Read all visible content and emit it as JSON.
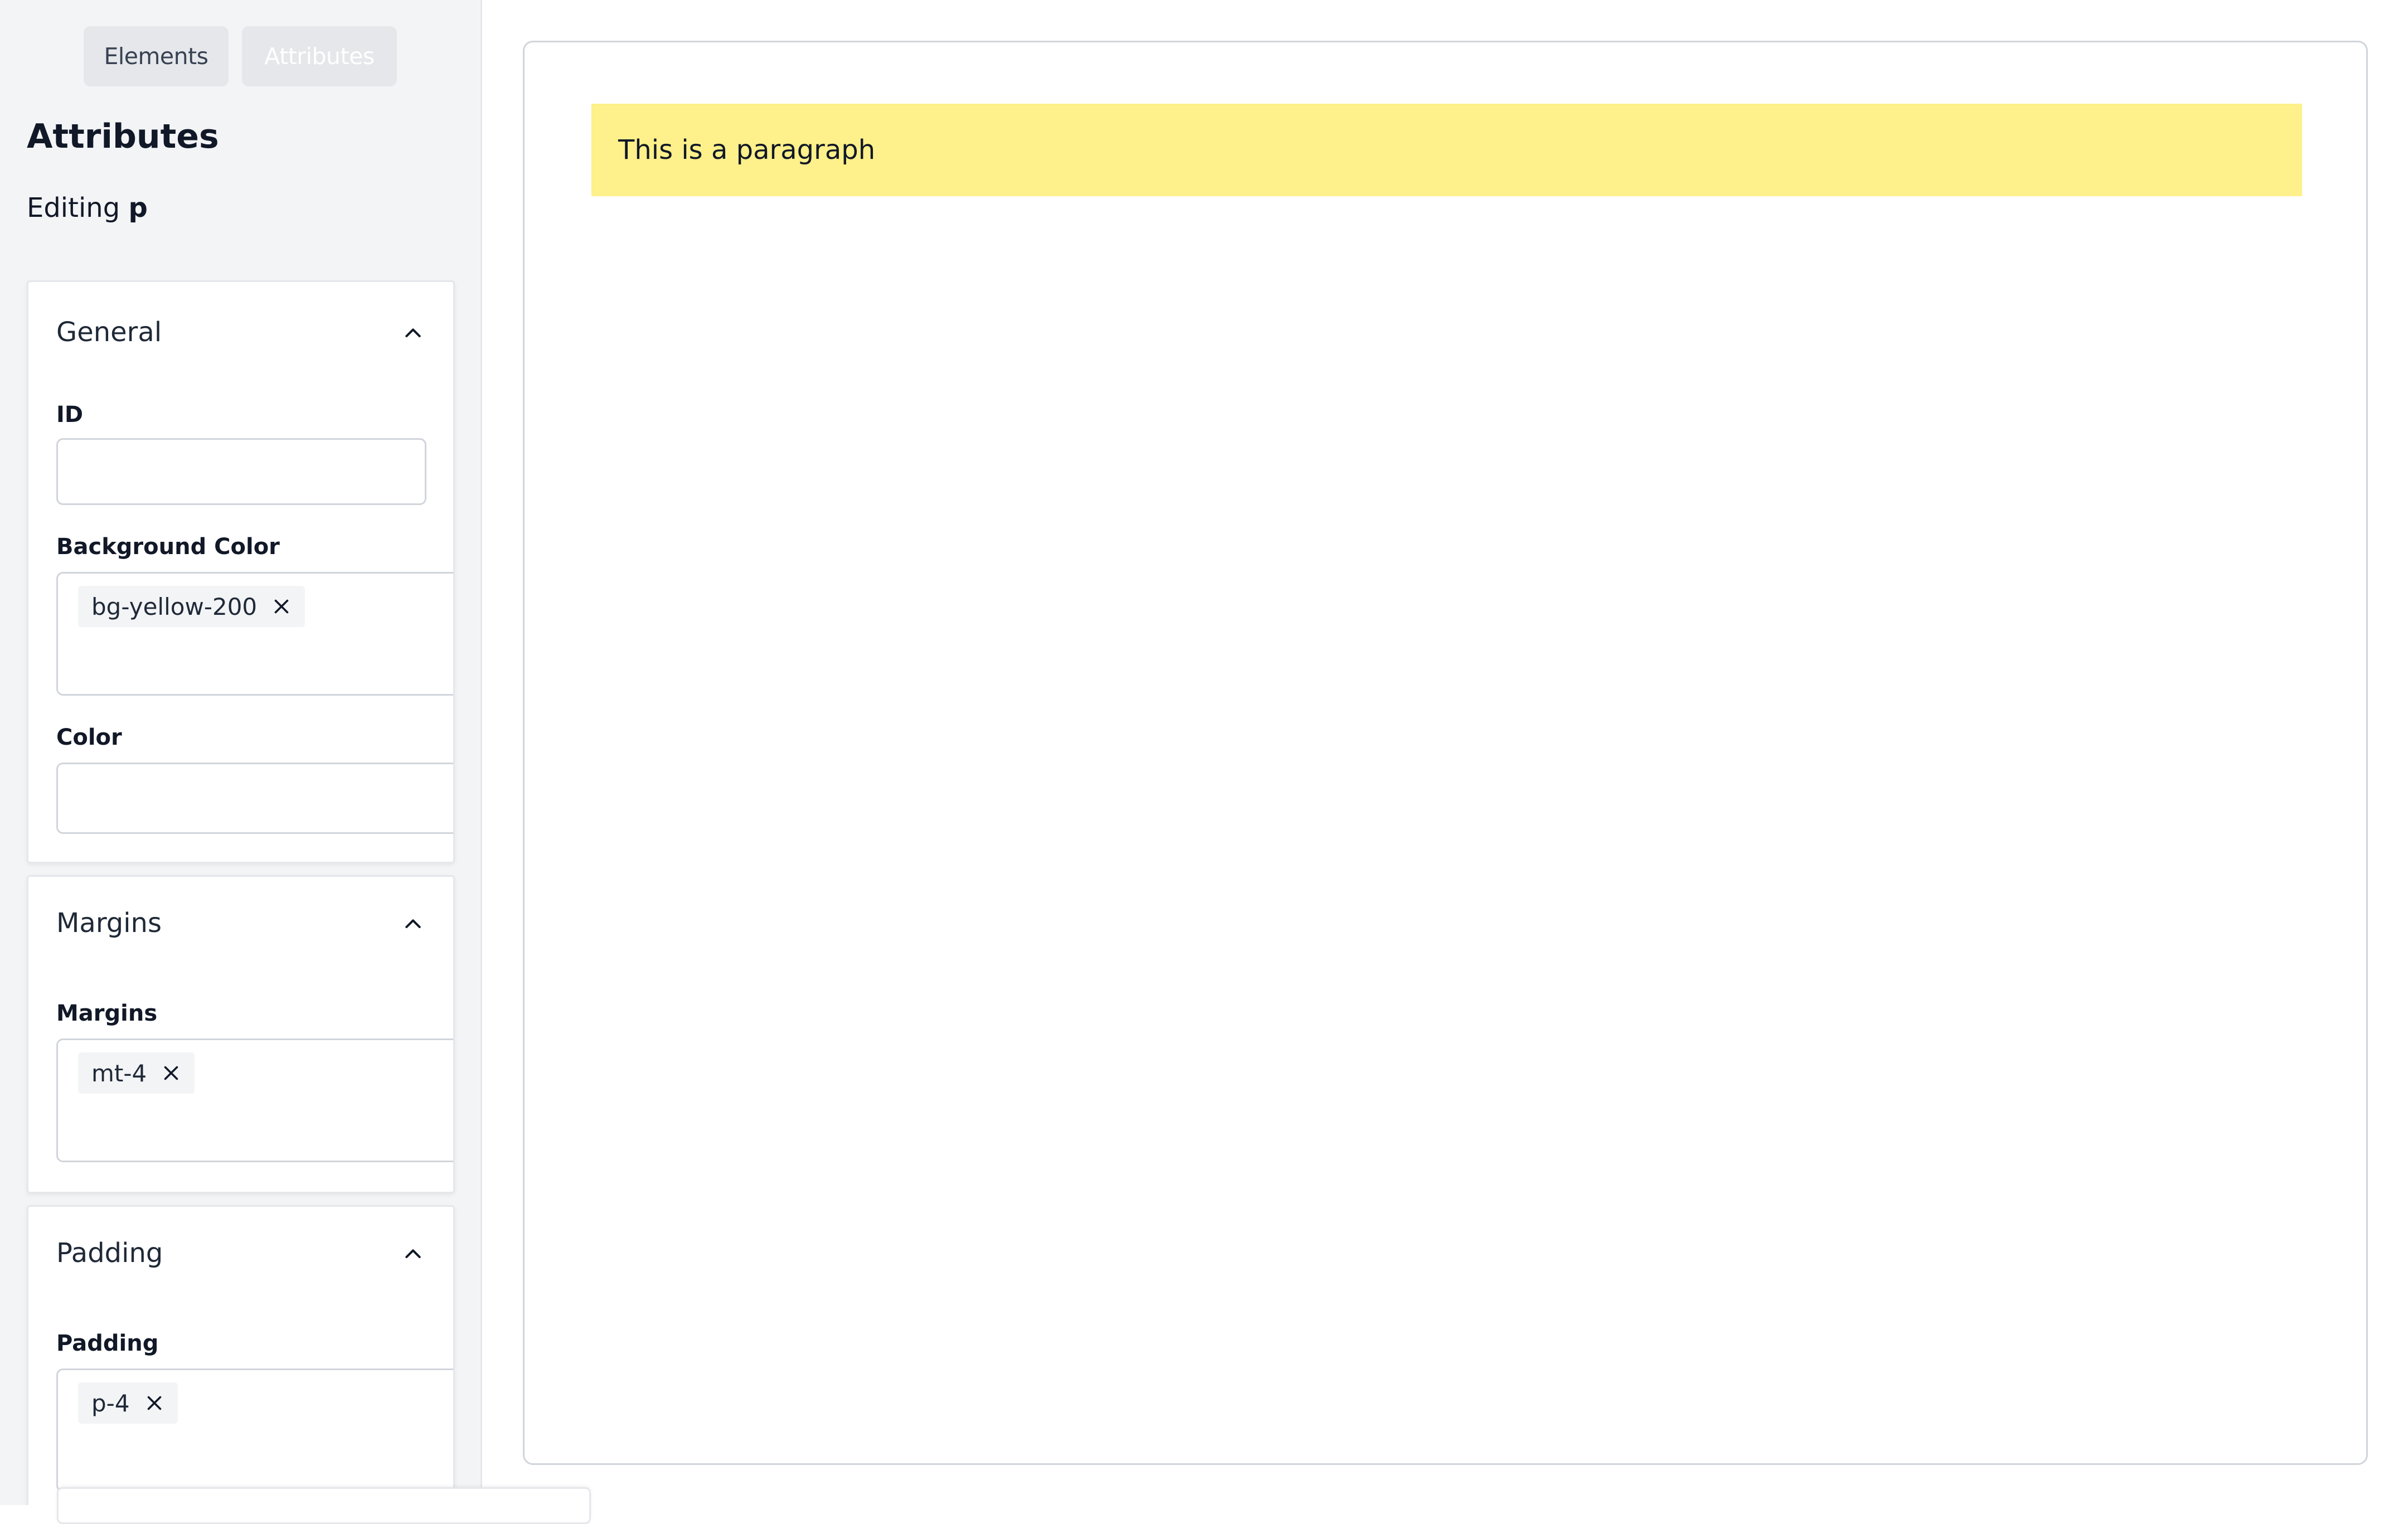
{
  "sidebar": {
    "tabs": [
      {
        "label": "Elements"
      },
      {
        "label": "Attributes"
      }
    ],
    "heading": "Attributes",
    "editing_prefix": "Editing",
    "editing_element": "p",
    "panels": {
      "general": {
        "title": "General",
        "fields": {
          "id": {
            "label": "ID",
            "value": ""
          },
          "background_color": {
            "label": "Background Color",
            "tags": [
              "bg-yellow-200"
            ]
          },
          "color": {
            "label": "Color",
            "value": ""
          }
        }
      },
      "margins": {
        "title": "Margins",
        "field_label": "Margins",
        "tags": [
          "mt-4"
        ]
      },
      "padding": {
        "title": "Padding",
        "field_label": "Padding",
        "tags": [
          "p-4"
        ]
      }
    }
  },
  "canvas": {
    "paragraph_text": "This is a paragraph",
    "paragraph_bg": "#fef08a"
  },
  "icons": {
    "panel_toggle": "chevron-up-icon",
    "tag_remove": "close-icon"
  }
}
